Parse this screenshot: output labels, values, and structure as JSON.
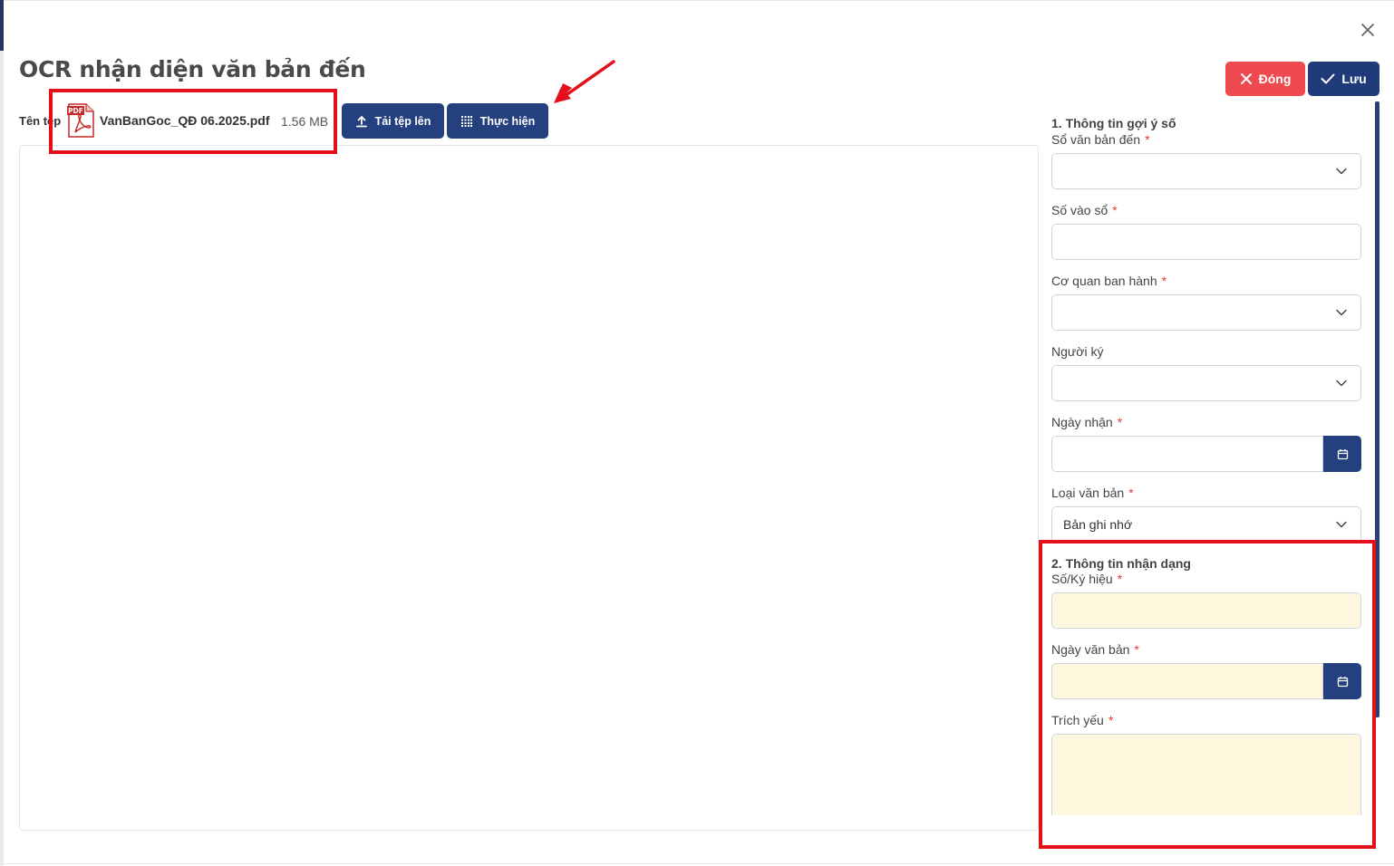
{
  "dialog": {
    "title": "OCR nhận diện văn bản đến",
    "close_label": "Đóng",
    "save_label": "Lưu"
  },
  "file": {
    "label": "Tên tệp",
    "name": "VanBanGoc_QĐ 06.2025.pdf",
    "size": "1.56 MB",
    "icon_text": "PDF",
    "upload_label": "Tải tệp lên",
    "run_label": "Thực hiện"
  },
  "form": {
    "section1_title": "1. Thông tin gợi ý số",
    "section2_title": "2. Thông tin nhận dạng",
    "fields": [
      {
        "label": "Sổ văn bản đến",
        "value": "",
        "type": "select",
        "required": true
      },
      {
        "label": "Số vào sổ",
        "value": "",
        "type": "text",
        "required": true
      },
      {
        "label": "Cơ quan ban hành",
        "value": "",
        "type": "select",
        "required": true
      },
      {
        "label": "Người ký",
        "value": "",
        "type": "select",
        "required": false
      },
      {
        "label": "Ngày nhận",
        "value": "",
        "type": "date",
        "required": true
      },
      {
        "label": "Loại văn bản",
        "value": "Bản ghi nhớ",
        "type": "select",
        "required": true
      },
      {
        "label": "Số/Ký hiệu",
        "value": "",
        "type": "text",
        "required": true
      },
      {
        "label": "Ngày văn bản",
        "value": "",
        "type": "date",
        "required": true
      },
      {
        "label": "Trích yếu",
        "value": "",
        "type": "textarea",
        "required": true
      }
    ],
    "required_mark": "*"
  },
  "colors": {
    "primary": "#24407f",
    "danger": "#ee4a4f",
    "highlight_field": "#fdf7dd",
    "annotation": "#e3101b"
  },
  "icons": {
    "close": "close-icon",
    "x_mark": "x-icon",
    "check": "check-icon",
    "upload": "upload-icon",
    "scan": "scan-grid-icon",
    "pdf": "pdf-file-icon",
    "chevron": "chevron-down-icon",
    "calendar": "calendar-icon"
  }
}
